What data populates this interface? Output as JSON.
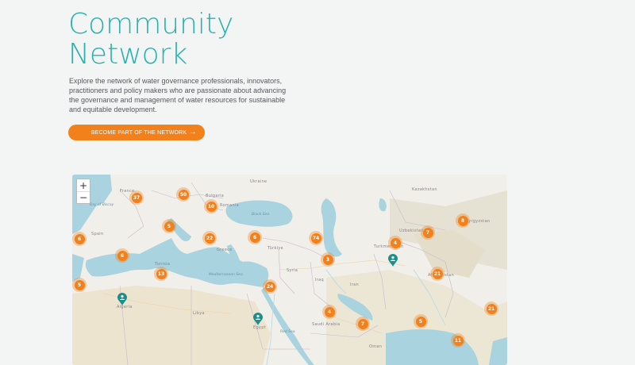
{
  "header": {
    "title_line1": "Community",
    "title_line2": "Network",
    "intro": "Explore the network of water governance professionals, innovators, practitioners and policy makers who are passionate about advancing the governance and management of water resources for sustainable and equitable development.",
    "cta_label": "BECOME PART OF THE NETWORK",
    "cta_icon": "arrow-right-icon"
  },
  "map": {
    "zoom_in": "+",
    "zoom_out": "−",
    "colors": {
      "water": "#a9d3df",
      "land": "#f1efe9",
      "desert": "#ece4cf",
      "mountain": "#e3ddc9",
      "cluster": "#f2801b",
      "pin": "#1a8f8c",
      "accent": "#2bb1b0"
    },
    "labels": [
      {
        "text": "Kazakhstan",
        "class": "country"
      },
      {
        "text": "Uzbekistan",
        "class": "country"
      },
      {
        "text": "Turkmenistan",
        "class": "country"
      },
      {
        "text": "Afghanistan",
        "class": "country"
      },
      {
        "text": "Kyrgyzstan",
        "class": "country"
      },
      {
        "text": "France",
        "class": "country"
      },
      {
        "text": "Ukraine",
        "class": "country"
      },
      {
        "text": "Romania",
        "class": "country"
      },
      {
        "text": "Bulgaria",
        "class": "country"
      },
      {
        "text": "Greece",
        "class": "country"
      },
      {
        "text": "Türkiye",
        "class": "country"
      },
      {
        "text": "Syria",
        "class": "country"
      },
      {
        "text": "Iraq",
        "class": "country"
      },
      {
        "text": "Iran",
        "class": "country"
      },
      {
        "text": "Libya",
        "class": "country"
      },
      {
        "text": "Algeria",
        "class": "country"
      },
      {
        "text": "Egypt",
        "class": "country"
      },
      {
        "text": "Saudi Arabia",
        "class": "country"
      },
      {
        "text": "Oman",
        "class": "country"
      },
      {
        "text": "Black Sea",
        "class": "sea"
      },
      {
        "text": "Mediterranean Sea",
        "class": "sea"
      },
      {
        "text": "Bay of Biscay",
        "class": "sea"
      },
      {
        "text": "Red Sea",
        "class": "sea"
      },
      {
        "text": "Spain",
        "class": "country"
      },
      {
        "text": "Tunisia",
        "class": "country"
      }
    ],
    "clusters": [
      {
        "count": "37"
      },
      {
        "count": "50"
      },
      {
        "count": "10"
      },
      {
        "count": "5"
      },
      {
        "count": "22"
      },
      {
        "count": "6"
      },
      {
        "count": "74"
      },
      {
        "count": "4"
      },
      {
        "count": "7"
      },
      {
        "count": "8"
      },
      {
        "count": "6"
      },
      {
        "count": "6"
      },
      {
        "count": "13"
      },
      {
        "count": "3"
      },
      {
        "count": "24"
      },
      {
        "count": "21"
      },
      {
        "count": "4"
      },
      {
        "count": "7"
      },
      {
        "count": "5"
      },
      {
        "count": "21"
      },
      {
        "count": "5"
      },
      {
        "count": "11"
      }
    ],
    "pins": [
      {
        "icon": "person-pin-icon"
      },
      {
        "icon": "person-pin-icon"
      },
      {
        "icon": "person-pin-icon"
      }
    ]
  }
}
